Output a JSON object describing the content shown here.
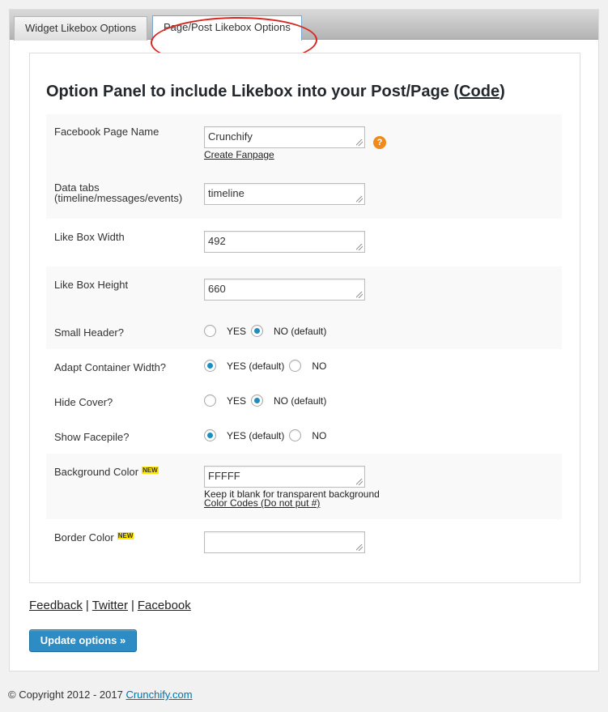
{
  "tabs": [
    {
      "label": "Widget Likebox Options",
      "active": false
    },
    {
      "label": "Page/Post Likebox Options",
      "active": true
    }
  ],
  "panel": {
    "title_prefix": "Option Panel to include Likebox into your Post/Page (",
    "title_code": "Code",
    "title_suffix": ")"
  },
  "fields": {
    "page_name": {
      "label": "Facebook Page Name",
      "value": "Crunchify",
      "link": "Create Fanpage",
      "help": "?"
    },
    "data_tabs": {
      "label_line1": "Data tabs",
      "label_line2": "(timeline/messages/events)",
      "value": "timeline"
    },
    "width": {
      "label": "Like Box Width",
      "value": "492"
    },
    "height": {
      "label": "Like Box Height",
      "value": "660"
    },
    "small_header": {
      "label": "Small Header?",
      "opt1": "YES",
      "opt2": "NO (default)",
      "selected": "NO (default)"
    },
    "adapt_width": {
      "label": "Adapt Container Width?",
      "opt1": "YES (default)",
      "opt2": "NO",
      "selected": "YES (default)"
    },
    "hide_cover": {
      "label": "Hide Cover?",
      "opt1": "YES",
      "opt2": "NO (default)",
      "selected": "NO (default)"
    },
    "show_facepile": {
      "label": "Show Facepile?",
      "opt1": "YES (default)",
      "opt2": "NO",
      "selected": "YES (default)"
    },
    "bg_color": {
      "label": "Background Color",
      "badge": "NEW",
      "value": "FFFFF",
      "note": "Keep it blank for transparent background",
      "link": "Color Codes (Do not put #)"
    },
    "border_color": {
      "label": "Border Color",
      "badge": "NEW",
      "value": ""
    }
  },
  "footer": {
    "links": [
      "Feedback",
      "Twitter",
      "Facebook"
    ],
    "separator": "|",
    "update_button": "Update options »",
    "copyright_text": "© Copyright 2012 - 2017 ",
    "copyright_link": "Crunchify.com"
  },
  "colors": {
    "accent": "#2d8cc4",
    "radio_dot": "#1e8cbe",
    "help": "#f08a1a",
    "highlight_ring": "#d6261f"
  }
}
